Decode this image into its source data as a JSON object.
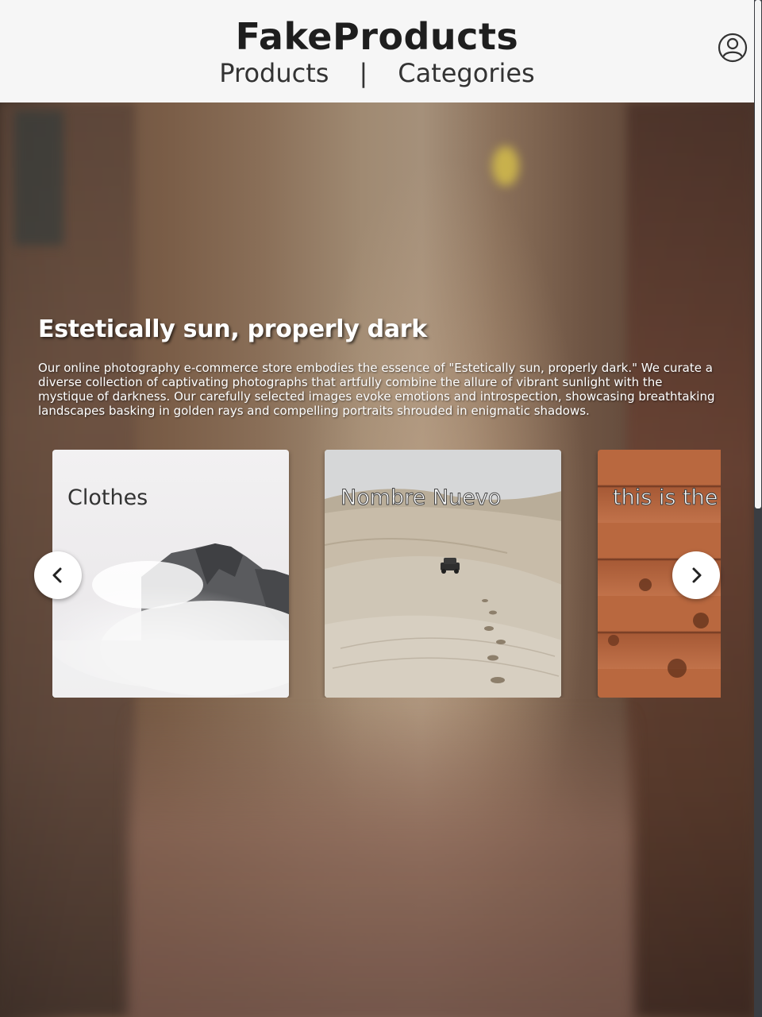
{
  "header": {
    "brand": "FakeProducts",
    "nav": {
      "products": "Products",
      "separator": "|",
      "categories": "Categories"
    },
    "profile_icon": "user-circle-icon"
  },
  "hero": {
    "title": "Estetically sun, properly dark",
    "description": "Our online photography e-commerce store embodies the essence of \"Estetically sun, properly dark.\" We curate a diverse collection of captivating photographs that artfully combine the allure of vibrant sunlight with the mystique of darkness. Our carefully selected images evoke emotions and introspection, showcasing breathtaking landscapes basking in golden rays and compelling portraits shrouded in enigmatic shadows."
  },
  "carousel": {
    "cards": [
      {
        "title": "Clothes",
        "image": "misty-mountain"
      },
      {
        "title": "Nombre Nuevo",
        "image": "desert-dunes-jeep"
      },
      {
        "title": "this is the",
        "image": "wood-planks"
      }
    ],
    "prev_icon": "chevron-left-icon",
    "next_icon": "chevron-right-icon"
  },
  "colors": {
    "header_bg": "#f6f6f6",
    "brand_text": "#1e1e1e",
    "hero_text": "#ffffff"
  }
}
